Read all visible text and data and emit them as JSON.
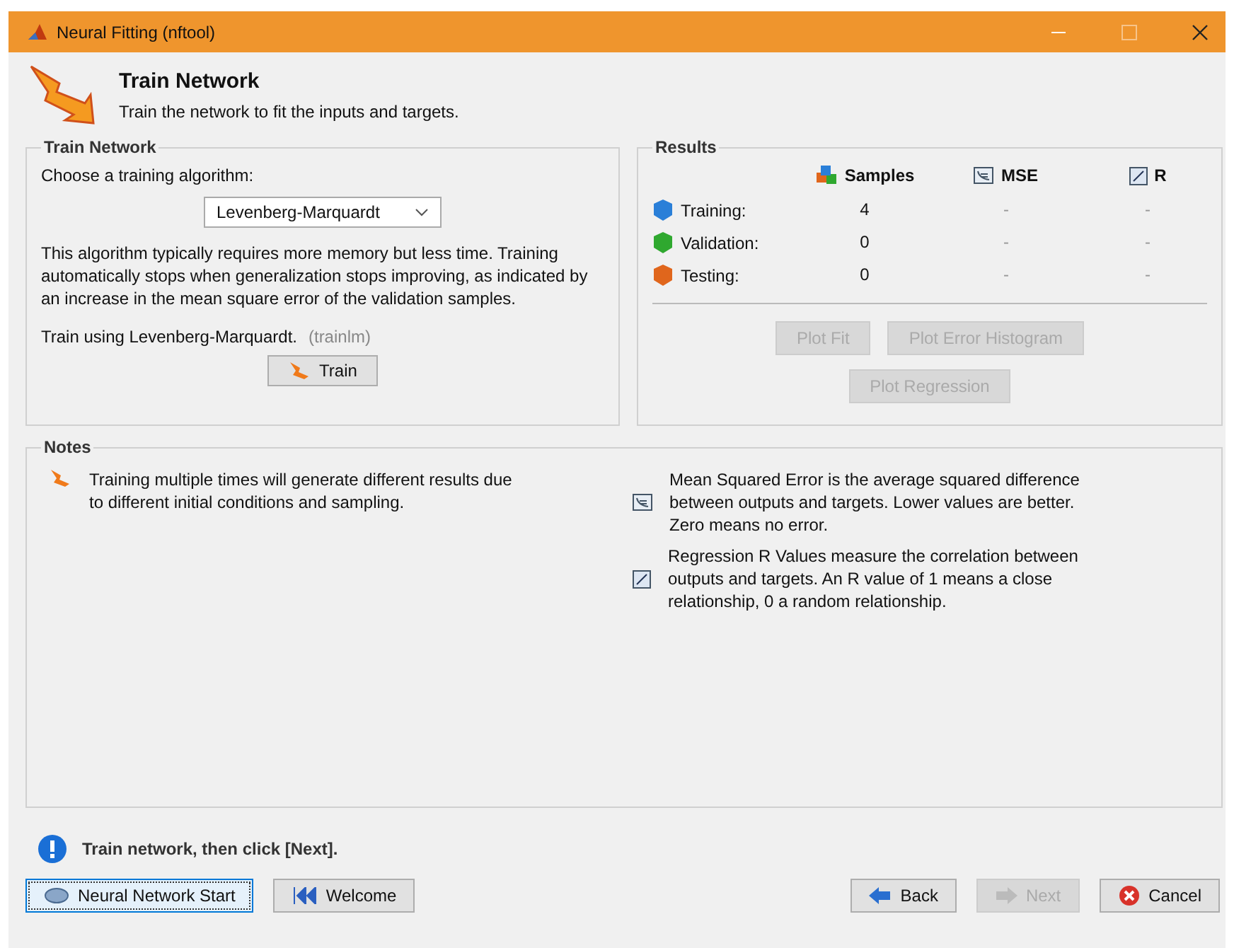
{
  "window": {
    "title": "Neural Fitting (nftool)"
  },
  "header": {
    "title": "Train Network",
    "subtitle": "Train the network to fit the inputs and targets."
  },
  "train_panel": {
    "title": "Train Network",
    "prompt": "Choose a training algorithm:",
    "algorithm": "Levenberg-Marquardt",
    "description": "This algorithm typically requires more memory but less time. Training automatically stops when generalization stops improving, as indicated by an increase in the mean square error of the validation samples.",
    "train_using": "Train using Levenberg-Marquardt.",
    "function": "(trainlm)",
    "train_button": "Train"
  },
  "results": {
    "title": "Results",
    "columns": [
      "Samples",
      "MSE",
      "R"
    ],
    "rows": [
      {
        "label": "Training:",
        "color": "#2a7fd8",
        "samples": "4",
        "mse": "-",
        "r": "-"
      },
      {
        "label": "Validation:",
        "color": "#2fa82f",
        "samples": "0",
        "mse": "-",
        "r": "-"
      },
      {
        "label": "Testing:",
        "color": "#e0661c",
        "samples": "0",
        "mse": "-",
        "r": "-"
      }
    ],
    "buttons": [
      {
        "label": "Plot Fit",
        "disabled": true
      },
      {
        "label": "Plot Error Histogram",
        "disabled": true
      },
      {
        "label": "Plot Regression",
        "disabled": true
      }
    ]
  },
  "notes": {
    "title": "Notes",
    "items": [
      {
        "kind": "train",
        "text": "Training multiple times will generate different results due to different initial conditions and sampling."
      },
      {
        "kind": "mse",
        "text": "Mean Squared Error is the average squared difference between outputs and targets. Lower values are better. Zero means no error."
      },
      {
        "kind": "r",
        "text": "Regression R Values measure the correlation between outputs and targets. An R value of 1 means a close relationship, 0 a random relationship."
      }
    ]
  },
  "status": "Train network, then click [Next].",
  "footer": {
    "left": [
      {
        "kind": "start",
        "label": "Neural Network Start",
        "disabled": false
      },
      {
        "kind": "welcome",
        "label": "Welcome",
        "disabled": false
      }
    ],
    "right": [
      {
        "kind": "back",
        "label": "Back",
        "disabled": false
      },
      {
        "kind": "next",
        "label": "Next",
        "disabled": true
      },
      {
        "kind": "cancel",
        "label": "Cancel",
        "disabled": false
      }
    ]
  }
}
